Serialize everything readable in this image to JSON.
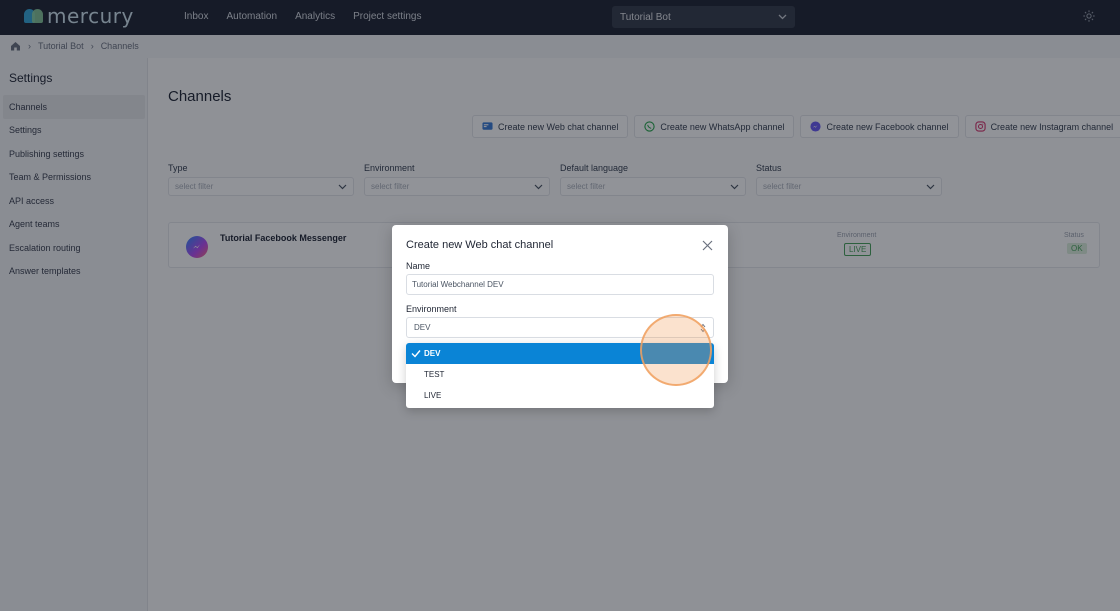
{
  "app": {
    "logo_text": "mercury",
    "nav": [
      "Inbox",
      "Automation",
      "Analytics",
      "Project settings"
    ],
    "bot_selector": "Tutorial Bot"
  },
  "breadcrumb": [
    "Tutorial Bot",
    "Channels"
  ],
  "sidebar": {
    "title": "Settings",
    "items": [
      {
        "label": "Channels",
        "active": true
      },
      {
        "label": "Settings"
      },
      {
        "label": "Publishing settings"
      },
      {
        "label": "Team & Permissions"
      },
      {
        "label": "API access"
      },
      {
        "label": "Agent teams"
      },
      {
        "label": "Escalation routing"
      },
      {
        "label": "Answer templates"
      }
    ]
  },
  "main": {
    "title": "Channels",
    "create_buttons": [
      {
        "label": "Create new Web chat channel",
        "icon": "webchat-icon"
      },
      {
        "label": "Create new WhatsApp channel",
        "icon": "whatsapp-icon"
      },
      {
        "label": "Create new Facebook channel",
        "icon": "messenger-icon"
      },
      {
        "label": "Create new Instagram channel",
        "icon": "instagram-icon"
      }
    ],
    "filters": [
      {
        "label": "Type",
        "placeholder": "select filter"
      },
      {
        "label": "Environment",
        "placeholder": "select filter"
      },
      {
        "label": "Default language",
        "placeholder": "select filter"
      },
      {
        "label": "Status",
        "placeholder": "select filter"
      }
    ],
    "channel_card": {
      "name": "Tutorial Facebook Messenger",
      "env_label": "Environment",
      "env_value": "LIVE",
      "status_label": "Status",
      "status_value": "OK"
    }
  },
  "modal": {
    "title": "Create new Web chat channel",
    "name_label": "Name",
    "name_value": "Tutorial Webchannel DEV",
    "env_label": "Environment",
    "env_value": "DEV",
    "options": [
      "DEV",
      "TEST",
      "LIVE"
    ],
    "selected_option": "DEV"
  },
  "colors": {
    "topbar": "#1f2533",
    "selected_option": "#0a84d6",
    "live_badge": "#4aa35c",
    "click_indicator": "#f0a05f"
  }
}
